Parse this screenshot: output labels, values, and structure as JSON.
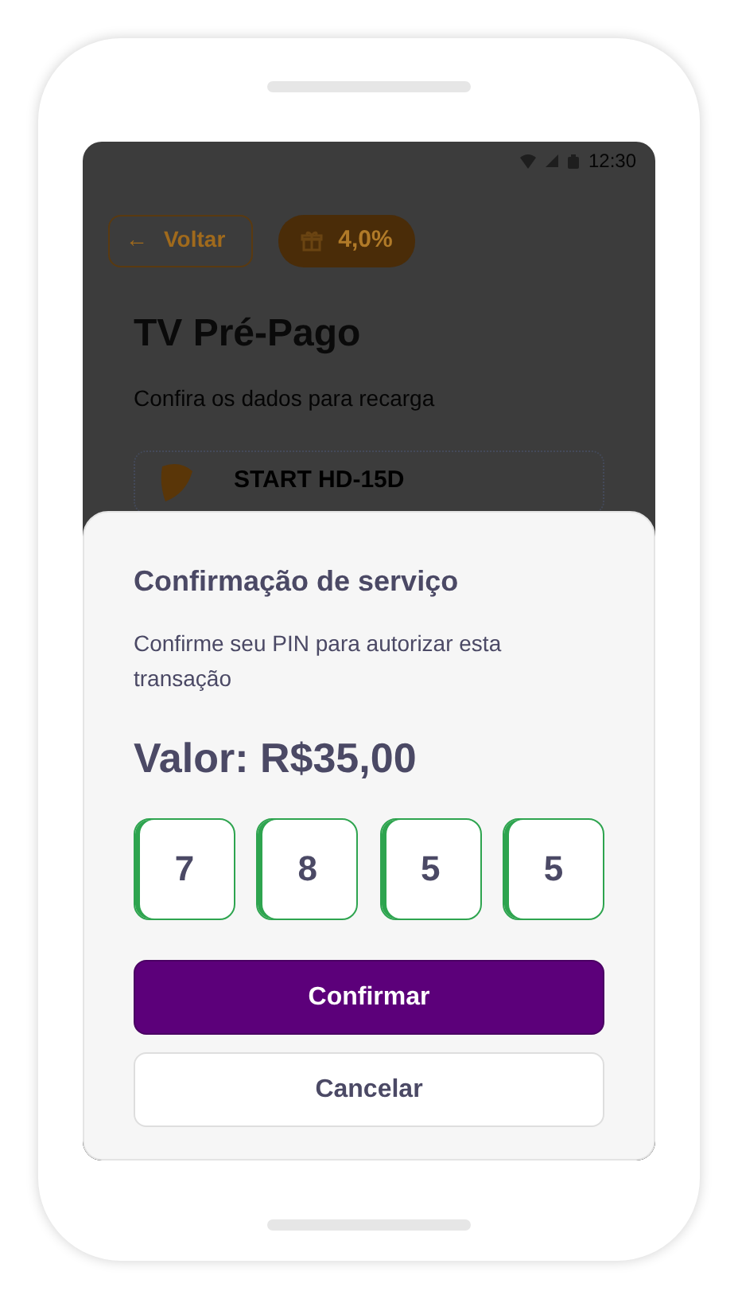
{
  "status_bar": {
    "time": "12:30"
  },
  "header": {
    "back_label": "Voltar",
    "back_icon": "←",
    "cashback": "4,0%"
  },
  "page": {
    "title": "TV Pré-Pago",
    "subtitle": "Confira os dados para recarga"
  },
  "product": {
    "name": "START HD-15D"
  },
  "sheet": {
    "title": "Confirmação de serviço",
    "description": "Confirme seu PIN para autorizar esta transação",
    "amount": "Valor: R$35,00",
    "pin": [
      {
        "digit": "7"
      },
      {
        "digit": "8"
      },
      {
        "digit": "5"
      },
      {
        "digit": "5"
      }
    ],
    "buttons": [
      {
        "label": "Confirmar",
        "kind": "primary"
      },
      {
        "label": "Cancelar",
        "kind": "secondary"
      }
    ]
  }
}
